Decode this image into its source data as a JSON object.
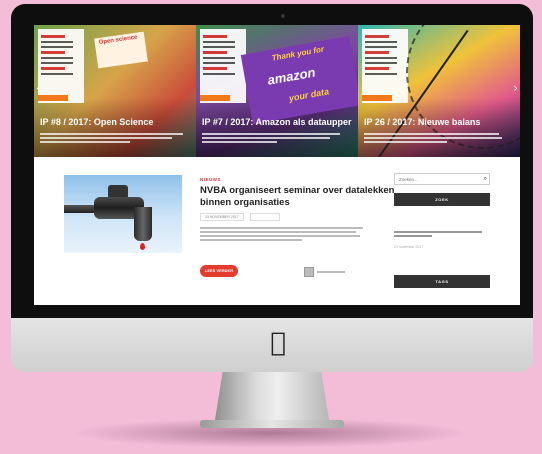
{
  "hero": {
    "slides": [
      {
        "title": "IP #8 / 2017: Open Science",
        "cover_text": "Open science",
        "excerpt": ""
      },
      {
        "title": "IP #7 / 2017: Amazon als dataupper",
        "cover_text": "amazon",
        "sign_texts": [
          "amazon",
          "Thank you for",
          "your data"
        ],
        "excerpt": ""
      },
      {
        "title": "IP 26 / 2017: Nieuwe balans",
        "cover_text": "",
        "excerpt": ""
      }
    ]
  },
  "post": {
    "category": "NIEUWS",
    "title": "NVBA organiseert seminar over datalekken binnen organisaties",
    "date": "23 NOVEMBER 2017",
    "excerpt": "",
    "read_more": "LEES VERDER",
    "author": ""
  },
  "sidebar": {
    "search_placeholder": "Zoeken...",
    "heading_1": "ZOEK",
    "link_text": "",
    "link_date": "23 november 2017",
    "heading_2": "TAGS"
  },
  "colors": {
    "background": "#f3bdd8",
    "accent": "#e33b2e",
    "sidebar_heading": "#333333"
  },
  "icons": {
    "search": "magnifier",
    "apple_logo": "apple-logo"
  }
}
